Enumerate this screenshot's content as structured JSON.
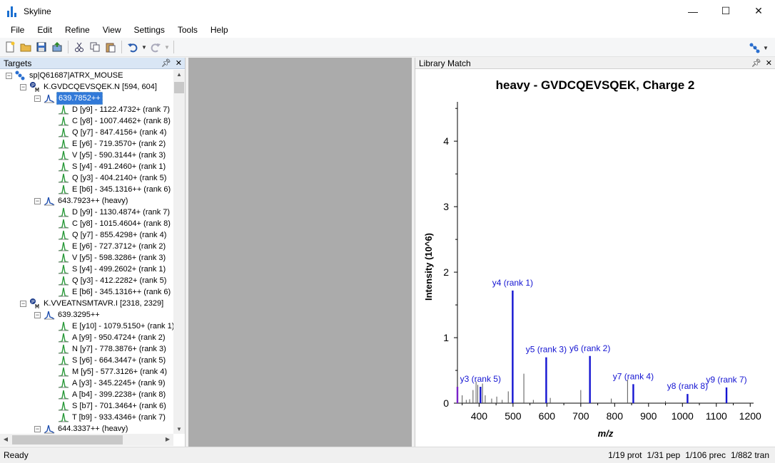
{
  "window": {
    "title": "Skyline",
    "minimize": "—",
    "maximize": "☐",
    "close": "✕"
  },
  "menu": [
    "File",
    "Edit",
    "Refine",
    "View",
    "Settings",
    "Tools",
    "Help"
  ],
  "targets_panel": {
    "title": "Targets",
    "tree": [
      {
        "depth": 0,
        "text": "sp|Q61687|ATRX_MOUSE",
        "kind": "protein",
        "expanded": true
      },
      {
        "depth": 1,
        "text": "K.GVDCQEVSQEK.N [594, 604]",
        "kind": "peptide",
        "expanded": true
      },
      {
        "depth": 2,
        "text": "639.7852++",
        "kind": "precursor",
        "expanded": true,
        "selected": true
      },
      {
        "depth": 3,
        "text": "D [y9] - 1122.4732+ (rank 7)",
        "kind": "transition"
      },
      {
        "depth": 3,
        "text": "C [y8] - 1007.4462+ (rank 8)",
        "kind": "transition"
      },
      {
        "depth": 3,
        "text": "Q [y7] - 847.4156+ (rank 4)",
        "kind": "transition"
      },
      {
        "depth": 3,
        "text": "E [y6] - 719.3570+ (rank 2)",
        "kind": "transition"
      },
      {
        "depth": 3,
        "text": "V [y5] - 590.3144+ (rank 3)",
        "kind": "transition"
      },
      {
        "depth": 3,
        "text": "S [y4] - 491.2460+ (rank 1)",
        "kind": "transition"
      },
      {
        "depth": 3,
        "text": "Q [y3] - 404.2140+ (rank 5)",
        "kind": "transition"
      },
      {
        "depth": 3,
        "text": "E [b6] - 345.1316++ (rank 6)",
        "kind": "transition"
      },
      {
        "depth": 2,
        "text": "643.7923++ (heavy)",
        "kind": "precursor",
        "expanded": true
      },
      {
        "depth": 3,
        "text": "D [y9] - 1130.4874+ (rank 7)",
        "kind": "transition"
      },
      {
        "depth": 3,
        "text": "C [y8] - 1015.4604+ (rank 8)",
        "kind": "transition"
      },
      {
        "depth": 3,
        "text": "Q [y7] - 855.4298+ (rank 4)",
        "kind": "transition"
      },
      {
        "depth": 3,
        "text": "E [y6] - 727.3712+ (rank 2)",
        "kind": "transition"
      },
      {
        "depth": 3,
        "text": "V [y5] - 598.3286+ (rank 3)",
        "kind": "transition"
      },
      {
        "depth": 3,
        "text": "S [y4] - 499.2602+ (rank 1)",
        "kind": "transition"
      },
      {
        "depth": 3,
        "text": "Q [y3] - 412.2282+ (rank 5)",
        "kind": "transition"
      },
      {
        "depth": 3,
        "text": "E [b6] - 345.1316++ (rank 6)",
        "kind": "transition"
      },
      {
        "depth": 1,
        "text": "K.VVEATNSMTAVR.I [2318, 2329]",
        "kind": "peptide",
        "expanded": true
      },
      {
        "depth": 2,
        "text": "639.3295++",
        "kind": "precursor",
        "expanded": true
      },
      {
        "depth": 3,
        "text": "E [y10] - 1079.5150+ (rank 1)",
        "kind": "transition"
      },
      {
        "depth": 3,
        "text": "A [y9] - 950.4724+ (rank 2)",
        "kind": "transition"
      },
      {
        "depth": 3,
        "text": "N [y7] - 778.3876+ (rank 3)",
        "kind": "transition"
      },
      {
        "depth": 3,
        "text": "S [y6] - 664.3447+ (rank 5)",
        "kind": "transition"
      },
      {
        "depth": 3,
        "text": "M [y5] - 577.3126+ (rank 4)",
        "kind": "transition"
      },
      {
        "depth": 3,
        "text": "A [y3] - 345.2245+ (rank 9)",
        "kind": "transition"
      },
      {
        "depth": 3,
        "text": "A [b4] - 399.2238+ (rank 8)",
        "kind": "transition"
      },
      {
        "depth": 3,
        "text": "S [b7] - 701.3464+ (rank 6)",
        "kind": "transition"
      },
      {
        "depth": 3,
        "text": "T [b9] - 933.4346+ (rank 7)",
        "kind": "transition"
      },
      {
        "depth": 2,
        "text": "644.3337++ (heavy)",
        "kind": "precursor",
        "expanded": true
      }
    ]
  },
  "library_panel": {
    "title": "Library Match"
  },
  "chart_data": {
    "type": "bar",
    "title": "heavy - GVDCQEVSQEK, Charge 2",
    "xlabel": "m/z",
    "ylabel": "Intensity (10^6)",
    "xlim": [
      336,
      1210
    ],
    "ylim": [
      0,
      4.6
    ],
    "xticks": [
      400,
      500,
      600,
      700,
      800,
      900,
      1000,
      1100,
      1200
    ],
    "yticks": [
      0,
      1,
      2,
      3,
      4
    ],
    "colors": {
      "matched": "#1414d2",
      "unmatched": "#555555",
      "b_ion": "#7a22c8"
    },
    "peaks": [
      {
        "x": 336,
        "y": 0.25,
        "kind": "b_ion",
        "label": ""
      },
      {
        "x": 404,
        "y": 0.25,
        "kind": "matched",
        "label": "y3 (rank 5)"
      },
      {
        "x": 499,
        "y": 1.72,
        "kind": "matched",
        "label": "y4 (rank 1)"
      },
      {
        "x": 598,
        "y": 0.7,
        "kind": "matched",
        "label": "y5 (rank 3)"
      },
      {
        "x": 727,
        "y": 0.72,
        "kind": "matched",
        "label": "y6 (rank 2)"
      },
      {
        "x": 855,
        "y": 0.29,
        "kind": "matched",
        "label": "y7 (rank 4)"
      },
      {
        "x": 1015,
        "y": 0.14,
        "kind": "matched",
        "label": "y8 (rank 8)"
      },
      {
        "x": 1130,
        "y": 0.24,
        "kind": "matched",
        "label": "y9 (rank 7)"
      },
      {
        "x": 350,
        "y": 0.12,
        "kind": "unmatched",
        "label": ""
      },
      {
        "x": 362,
        "y": 0.05,
        "kind": "unmatched",
        "label": ""
      },
      {
        "x": 372,
        "y": 0.06,
        "kind": "unmatched",
        "label": ""
      },
      {
        "x": 382,
        "y": 0.2,
        "kind": "unmatched",
        "label": ""
      },
      {
        "x": 391,
        "y": 0.33,
        "kind": "unmatched",
        "label": ""
      },
      {
        "x": 396,
        "y": 0.28,
        "kind": "unmatched",
        "label": ""
      },
      {
        "x": 410,
        "y": 0.3,
        "kind": "unmatched",
        "label": ""
      },
      {
        "x": 418,
        "y": 0.12,
        "kind": "unmatched",
        "label": ""
      },
      {
        "x": 437,
        "y": 0.07,
        "kind": "unmatched",
        "label": ""
      },
      {
        "x": 452,
        "y": 0.1,
        "kind": "unmatched",
        "label": ""
      },
      {
        "x": 468,
        "y": 0.05,
        "kind": "unmatched",
        "label": ""
      },
      {
        "x": 486,
        "y": 0.18,
        "kind": "unmatched",
        "label": ""
      },
      {
        "x": 532,
        "y": 0.45,
        "kind": "unmatched",
        "label": ""
      },
      {
        "x": 560,
        "y": 0.05,
        "kind": "unmatched",
        "label": ""
      },
      {
        "x": 610,
        "y": 0.08,
        "kind": "unmatched",
        "label": ""
      },
      {
        "x": 700,
        "y": 0.2,
        "kind": "unmatched",
        "label": ""
      },
      {
        "x": 790,
        "y": 0.07,
        "kind": "unmatched",
        "label": ""
      },
      {
        "x": 838,
        "y": 0.36,
        "kind": "unmatched",
        "label": ""
      },
      {
        "x": 950,
        "y": 0.03,
        "kind": "unmatched",
        "label": ""
      }
    ]
  },
  "status": {
    "left": "Ready",
    "items": [
      "1/19 prot",
      "1/31 pep",
      "1/106 prec",
      "1/882 tran"
    ]
  }
}
